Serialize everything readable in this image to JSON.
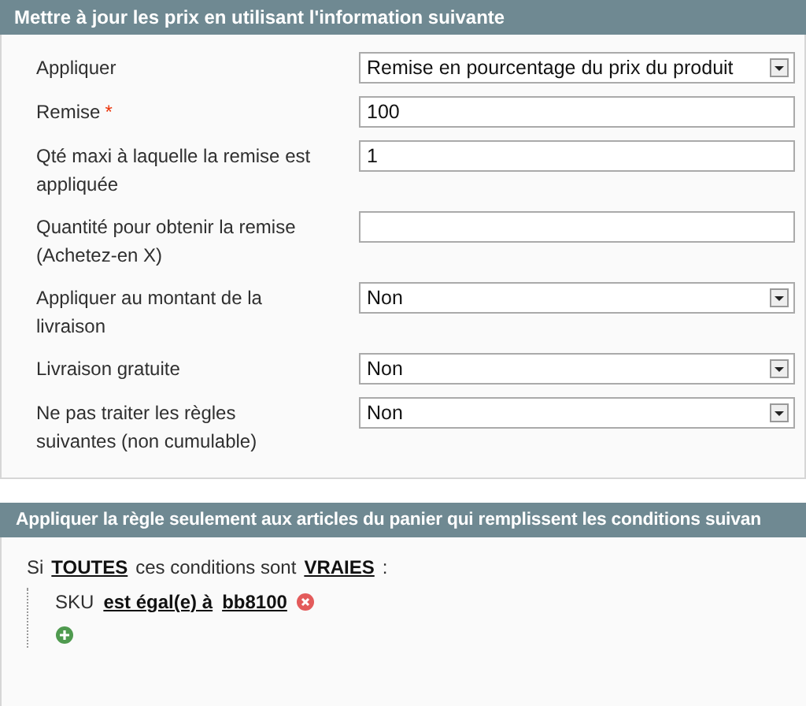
{
  "section_1": {
    "title": "Mettre à jour les prix en utilisant l'information suivante",
    "fields": [
      {
        "label": "Appliquer",
        "kind": "select",
        "value": "Remise en pourcentage du prix du produit"
      },
      {
        "label": "Remise",
        "kind": "input",
        "value": "100",
        "required_mark": "*"
      },
      {
        "label": "Qté maxi à laquelle la remise est appliquée",
        "kind": "input",
        "value": "1"
      },
      {
        "label": "Quantité pour obtenir la remise (Achetez-en X)",
        "kind": "input"
      },
      {
        "label": "Appliquer au montant de la livraison",
        "kind": "select",
        "value": "Non"
      },
      {
        "label": "Livraison gratuite",
        "kind": "select",
        "value": "Non"
      },
      {
        "label": "Ne pas traiter les règles suivantes (non cumulable)",
        "kind": "select",
        "value": "Non"
      }
    ]
  },
  "section_2": {
    "title": "Appliquer la règle seulement aux articles du panier qui remplissent les conditions suivan",
    "condition_prefix": "Si",
    "aggregator": "TOUTES",
    "condition_middle": "ces conditions sont",
    "truth": "VRAIES",
    "condition_suffix": ":",
    "conditions": [
      {
        "attribute": "SKU",
        "operator": "est égal(e) à",
        "value": "bb8100"
      }
    ]
  }
}
